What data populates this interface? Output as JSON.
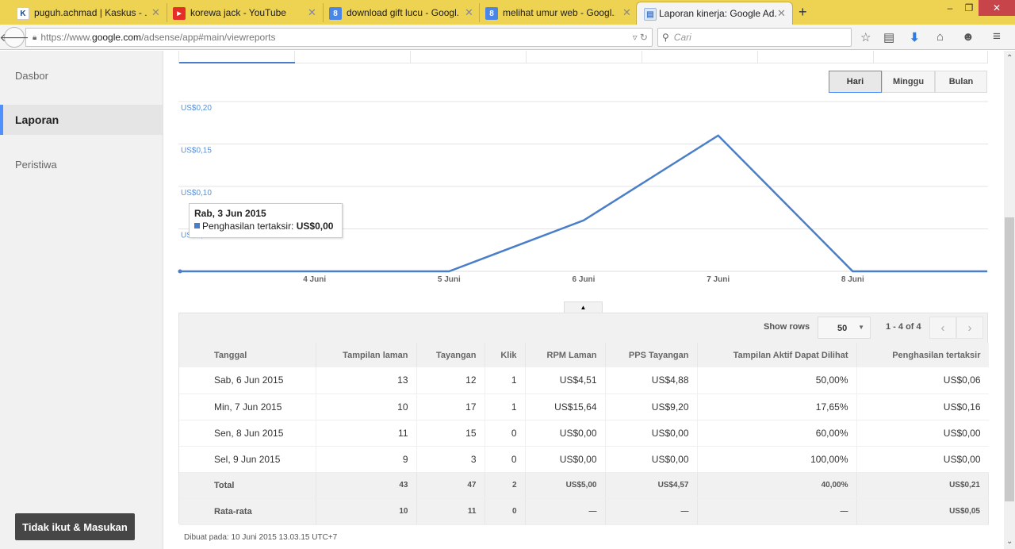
{
  "browser": {
    "tabs": [
      {
        "label": "puguh.achmad | Kaskus - ...",
        "icon": "kaskus-icon",
        "icon_color": "#1b4b8c",
        "icon_glyph": "K"
      },
      {
        "label": "korewa jack - YouTube",
        "icon": "youtube-icon",
        "icon_color": "#e52d27",
        "icon_glyph": "▶"
      },
      {
        "label": "download gift lucu - Googl...",
        "icon": "google-icon",
        "icon_color": "#4a86e8",
        "icon_glyph": "8"
      },
      {
        "label": "melihat umur web - Googl...",
        "icon": "google-icon",
        "icon_color": "#4a86e8",
        "icon_glyph": "8"
      },
      {
        "label": "Laporan kinerja: Google Ad...",
        "icon": "adsense-page-icon",
        "icon_color": "#6a9fd8",
        "icon_glyph": "▤",
        "active": true
      }
    ],
    "url_prefix": "https://www.",
    "url_domain": "google.com",
    "url_path": "/adsense/app#main/viewreports",
    "search_placeholder": "Cari"
  },
  "sidebar": {
    "items": [
      {
        "label": "Dasbor"
      },
      {
        "label": "Laporan",
        "active": true
      },
      {
        "label": "Peristiwa"
      }
    ],
    "optout_label": "Tidak ikut & Masukan"
  },
  "period_buttons": [
    {
      "label": "Hari",
      "selected": true
    },
    {
      "label": "Minggu"
    },
    {
      "label": "Bulan"
    }
  ],
  "tooltip": {
    "date": "Rab, 3 Jun 2015",
    "series": "Penghasilan tertaksir:",
    "value": "US$0,00"
  },
  "chart_data": {
    "type": "line",
    "title": "",
    "xlabel": "",
    "ylabel": "Penghasilan tertaksir",
    "x": [
      "3 Juni",
      "4 Juni",
      "5 Juni",
      "6 Juni",
      "7 Juni",
      "8 Juni",
      "9 Juni"
    ],
    "x_tick_labels": [
      "4 Juni",
      "5 Juni",
      "6 Juni",
      "7 Juni",
      "8 Juni"
    ],
    "series": [
      {
        "name": "Penghasilan tertaksir",
        "color": "#4a7ec9",
        "values": [
          0,
          0,
          0,
          0.06,
          0.16,
          0,
          0
        ]
      }
    ],
    "y_ticks": [
      0.05,
      0.1,
      0.15,
      0.2
    ],
    "y_tick_labels": [
      "US$0,05",
      "US$0,10",
      "US$0,15",
      "US$0,20"
    ],
    "ylim": [
      0,
      0.2
    ],
    "grid": true
  },
  "table": {
    "show_rows_label": "Show rows",
    "rows_per_page": "50",
    "page_info": "1 - 4 of 4",
    "columns": [
      "Tanggal",
      "Tampilan laman",
      "Tayangan",
      "Klik",
      "RPM Laman",
      "PPS Tayangan",
      "Tampilan Aktif Dapat Dilihat",
      "Penghasilan tertaksir"
    ],
    "rows": [
      [
        "Sab, 6 Jun 2015",
        "13",
        "12",
        "1",
        "US$4,51",
        "US$4,88",
        "50,00%",
        "US$0,06"
      ],
      [
        "Min, 7 Jun 2015",
        "10",
        "17",
        "1",
        "US$15,64",
        "US$9,20",
        "17,65%",
        "US$0,16"
      ],
      [
        "Sen, 8 Jun 2015",
        "11",
        "15",
        "0",
        "US$0,00",
        "US$0,00",
        "60,00%",
        "US$0,00"
      ],
      [
        "Sel, 9 Jun 2015",
        "9",
        "3",
        "0",
        "US$0,00",
        "US$0,00",
        "100,00%",
        "US$0,00"
      ]
    ],
    "total": [
      "Total",
      "43",
      "47",
      "2",
      "US$5,00",
      "US$4,57",
      "40,00%",
      "US$0,21"
    ],
    "average": [
      "Rata-rata",
      "10",
      "11",
      "0",
      "—",
      "—",
      "—",
      "US$0,05"
    ]
  },
  "footer_note": "Dibuat pada: 10 Juni 2015 13.03.15 UTC+7"
}
